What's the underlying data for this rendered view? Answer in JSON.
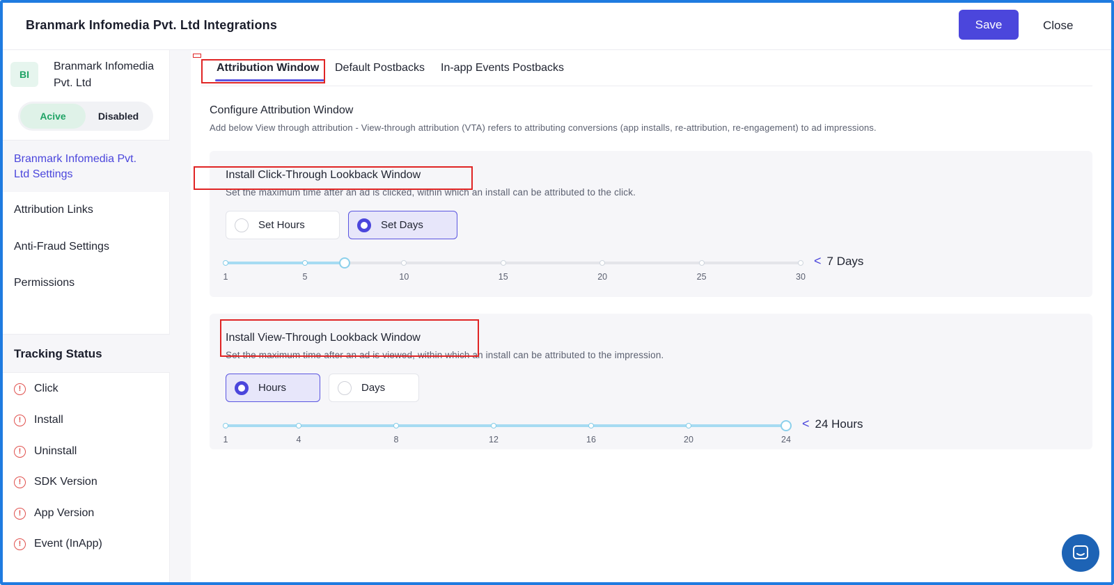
{
  "header": {
    "title": "Branmark Infomedia Pvt. Ltd Integrations",
    "save_label": "Save",
    "close_label": "Close"
  },
  "sidebar": {
    "avatar_initials": "BI",
    "brand_name": "Branmark Infomedia Pvt. Ltd",
    "status": {
      "active_label": "Acive",
      "disabled_label": "Disabled",
      "selected": "Acive"
    },
    "nav": [
      {
        "label": "Branmark Infomedia Pvt. Ltd Settings",
        "active": true
      },
      {
        "label": "Attribution Links"
      },
      {
        "label": "Anti-Fraud Settings"
      },
      {
        "label": "Permissions"
      }
    ],
    "tracking_title": "Tracking Status",
    "tracking_items": [
      {
        "label": "Click",
        "icon": "alert-circle-icon"
      },
      {
        "label": "Install",
        "icon": "alert-circle-icon"
      },
      {
        "label": "Uninstall",
        "icon": "alert-circle-icon"
      },
      {
        "label": "SDK Version",
        "icon": "alert-circle-icon"
      },
      {
        "label": "App Version",
        "icon": "alert-circle-icon"
      },
      {
        "label": "Event (InApp)",
        "icon": "alert-circle-icon"
      }
    ]
  },
  "tabs": [
    {
      "label": "Attribution Window",
      "active": true
    },
    {
      "label": "Default Postbacks"
    },
    {
      "label": "In-app Events Postbacks"
    }
  ],
  "main": {
    "title": "Configure Attribution Window",
    "description": "Add below View through attribution - View-through attribution (VTA) refers to attributing conversions (app installs, re-attribution, re-engagement) to ad impressions."
  },
  "click_through": {
    "title": "Install Click-Through Lookback Window",
    "description": "Set the maximum time after an ad is clicked, within which an install can be attributed to the click.",
    "options": [
      {
        "label": "Set Hours",
        "selected": false
      },
      {
        "label": "Set Days",
        "selected": true
      }
    ],
    "slider": {
      "min": 1,
      "max": 30,
      "value": 7,
      "ticks": [
        "1",
        "5",
        "10",
        "15",
        "20",
        "25",
        "30"
      ],
      "value_label": "7 Days"
    }
  },
  "view_through": {
    "title": "Install View-Through Lookback Window",
    "description": "Set the maximum time after an ad is viewed, within which an install can be attributed to the impression.",
    "options": [
      {
        "label": "Hours",
        "selected": true
      },
      {
        "label": "Days",
        "selected": false
      }
    ],
    "slider": {
      "min": 1,
      "max": 24,
      "value": 24,
      "ticks": [
        "1",
        "4",
        "8",
        "12",
        "16",
        "20",
        "24"
      ],
      "value_label": "24 Hours"
    }
  },
  "colors": {
    "accent": "#4b46dc",
    "active_green": "#1fa365",
    "alert_red": "#e0504d",
    "annotation_red": "#e02424",
    "frame_blue": "#1f7be0"
  },
  "chat_widget": {
    "icon": "chat-bubble-icon"
  }
}
